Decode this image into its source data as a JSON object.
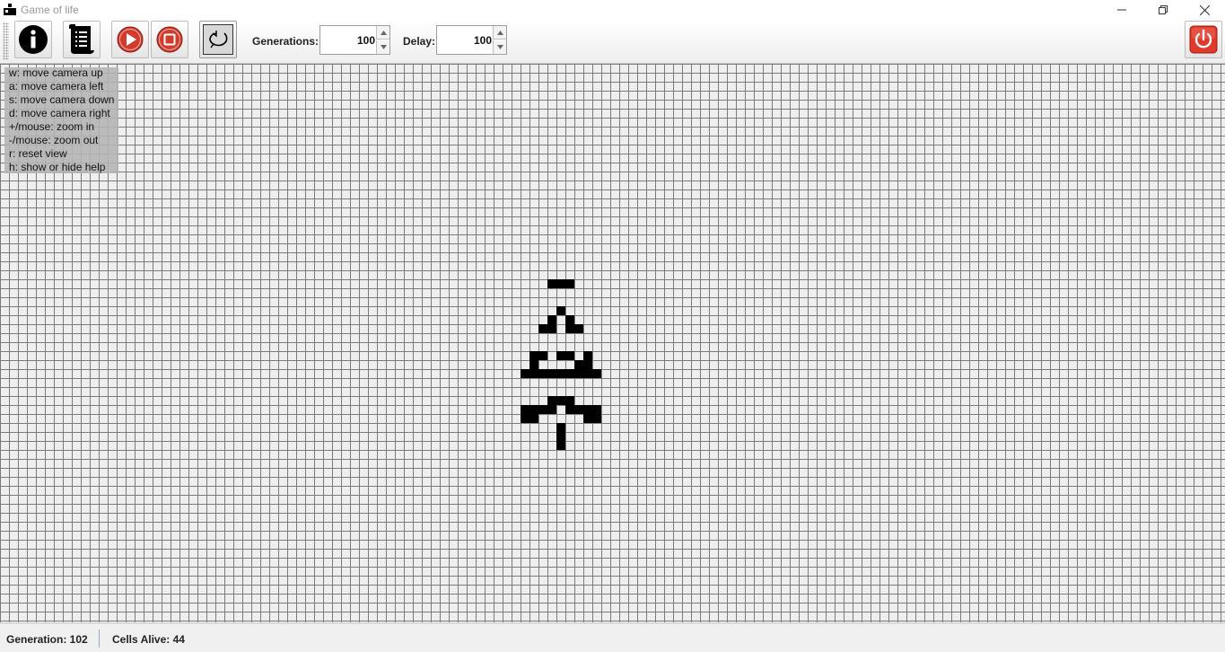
{
  "window": {
    "title": "Game of life",
    "icon": "app-blocks-icon",
    "controls": [
      "minimize-icon",
      "restore-icon",
      "close-icon"
    ]
  },
  "toolbar": {
    "buttons": [
      {
        "name": "info",
        "icon": "info-icon"
      },
      {
        "name": "rules",
        "icon": "scroll-list-icon"
      },
      {
        "name": "play",
        "icon": "play-icon"
      },
      {
        "name": "stop",
        "icon": "stop-icon"
      },
      {
        "name": "reset",
        "icon": "loop-arrow-icon"
      },
      {
        "name": "exit",
        "icon": "power-icon"
      }
    ],
    "generations_label": "Generations:",
    "generations_value": "100",
    "delay_label": "Delay:",
    "delay_value": "100"
  },
  "help": {
    "lines": [
      "w: move camera up",
      "a: move camera left",
      "s: move camera down",
      "d: move camera right",
      "+/mouse: zoom in",
      "-/mouse: zoom out",
      "r: reset view",
      "h: show or hide help"
    ]
  },
  "board": {
    "cell_color": "#000000",
    "grid_line_color": "#7a7a7a",
    "background_color": "#eeeeee",
    "live_cells": [
      [
        61,
        24
      ],
      [
        62,
        24
      ],
      [
        63,
        24
      ],
      [
        62,
        27
      ],
      [
        61,
        28
      ],
      [
        63,
        28
      ],
      [
        60,
        29
      ],
      [
        61,
        29
      ],
      [
        63,
        29
      ],
      [
        64,
        29
      ],
      [
        59,
        32
      ],
      [
        60,
        32
      ],
      [
        62,
        32
      ],
      [
        63,
        32
      ],
      [
        65,
        32
      ],
      [
        59,
        33
      ],
      [
        64,
        33
      ],
      [
        65,
        33
      ],
      [
        58,
        34
      ],
      [
        59,
        34
      ],
      [
        60,
        34
      ],
      [
        61,
        34
      ],
      [
        62,
        34
      ],
      [
        63,
        34
      ],
      [
        64,
        34
      ],
      [
        65,
        34
      ],
      [
        66,
        34
      ],
      [
        61,
        37
      ],
      [
        62,
        37
      ],
      [
        63,
        37
      ],
      [
        58,
        38
      ],
      [
        59,
        38
      ],
      [
        60,
        38
      ],
      [
        61,
        38
      ],
      [
        63,
        38
      ],
      [
        64,
        38
      ],
      [
        65,
        38
      ],
      [
        66,
        38
      ],
      [
        58,
        39
      ],
      [
        59,
        39
      ],
      [
        65,
        39
      ],
      [
        66,
        39
      ],
      [
        62,
        40
      ],
      [
        62,
        41
      ],
      [
        62,
        42
      ]
    ]
  },
  "status": {
    "generation": "Generation: 102",
    "cells_alive": "Cells Alive: 44"
  }
}
